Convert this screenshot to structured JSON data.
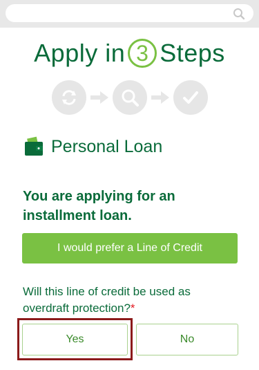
{
  "search": {
    "placeholder": ""
  },
  "brand": {
    "before": "Apply in",
    "number": "3",
    "after": "Steps"
  },
  "steps": [
    {
      "icon": "refresh-icon"
    },
    {
      "icon": "magnifier-icon"
    },
    {
      "icon": "checkmark-icon"
    }
  ],
  "product": {
    "icon": "wallet-icon",
    "title": "Personal Loan"
  },
  "heading": "You are applying for an installment loan.",
  "prefer_button": "I would prefer a Line of Credit",
  "question": {
    "text": "Will this line of credit be used as overdraft protection?",
    "required_mark": "*"
  },
  "options": {
    "yes": "Yes",
    "no": "No"
  },
  "colors": {
    "brand_green": "#0a6b3a",
    "accent_green": "#7ac143",
    "highlight": "#8b1a1a",
    "required": "#e31b23"
  }
}
